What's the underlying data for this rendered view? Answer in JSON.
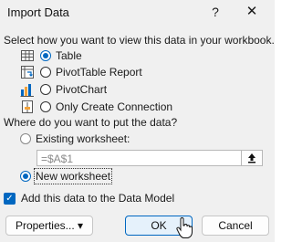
{
  "window": {
    "title": "Import Data",
    "help_label": "?",
    "close_label": "✕"
  },
  "view_section": {
    "prompt": "Select how you want to view this data in your workbook.",
    "options": [
      {
        "label": "Table",
        "icon": "table-icon",
        "selected": true
      },
      {
        "label": "PivotTable Report",
        "icon": "pivottable-icon",
        "selected": false
      },
      {
        "label": "PivotChart",
        "icon": "pivotchart-icon",
        "selected": false
      },
      {
        "label": "Only Create Connection",
        "icon": "connection-icon",
        "selected": false
      }
    ]
  },
  "place_section": {
    "prompt": "Where do you want to put the data?",
    "existing_label": "Existing worksheet:",
    "reference_value": "=$A$1",
    "collapse_icon": "collapse-arrow-icon",
    "new_label": "New worksheet",
    "new_selected": true
  },
  "data_model": {
    "label": "Add this data to the Data Model",
    "checked": true
  },
  "buttons": {
    "properties": "Properties...",
    "properties_arrow": "▾",
    "ok": "OK",
    "cancel": "Cancel"
  },
  "colors": {
    "accent": "#0067c0",
    "background": "#f0f0f0"
  }
}
